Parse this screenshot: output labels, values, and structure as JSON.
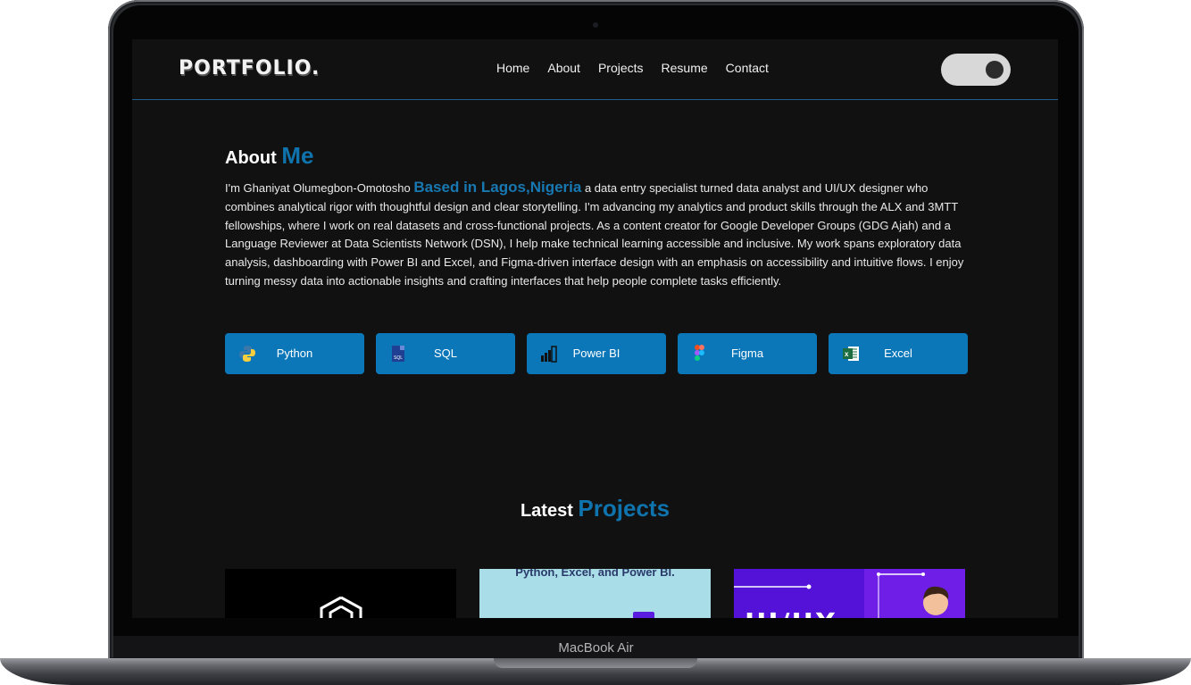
{
  "device": {
    "model_label": "MacBook Air"
  },
  "header": {
    "logo": "PORTFOLIO.",
    "nav": [
      "Home",
      "About",
      "Projects",
      "Resume",
      "Contact"
    ]
  },
  "about": {
    "heading_prefix": "About",
    "heading_accent": "Me",
    "intro": "I'm Ghaniyat Olumegbon-Omotosho",
    "location": "Based in Lagos,Nigeria",
    "bio": "a data entry specialist turned data analyst and UI/UX designer who combines analytical rigor with thoughtful design and clear storytelling. I'm advancing my analytics and product skills through the ALX and 3MTT fellowships, where I work on real datasets and cross-functional projects. As a content creator for Google Developer Groups (GDG Ajah) and a Language Reviewer at Data Scientists Network (DSN), I help make technical learning accessible and inclusive. My work spans exploratory data analysis, dashboarding with Power BI and Excel, and Figma-driven interface design with an emphasis on accessibility and intuitive flows. I enjoy turning messy data into actionable insights and crafting interfaces that help people complete tasks efficiently.",
    "skills": [
      {
        "label": "Python",
        "icon": "python-icon"
      },
      {
        "label": "SQL",
        "icon": "sql-icon"
      },
      {
        "label": "Power BI",
        "icon": "power-bi-icon"
      },
      {
        "label": "Figma",
        "icon": "figma-icon"
      },
      {
        "label": "Excel",
        "icon": "excel-icon"
      }
    ]
  },
  "projects": {
    "heading_prefix": "Latest",
    "heading_accent": "Projects",
    "cards": [
      {
        "caption": ""
      },
      {
        "caption": "Python, Excel, and Power BI."
      },
      {
        "caption": "UI/UX"
      }
    ]
  },
  "colors": {
    "accent": "#0f73ad",
    "skill_button": "#0b77b9",
    "background": "#111111"
  }
}
